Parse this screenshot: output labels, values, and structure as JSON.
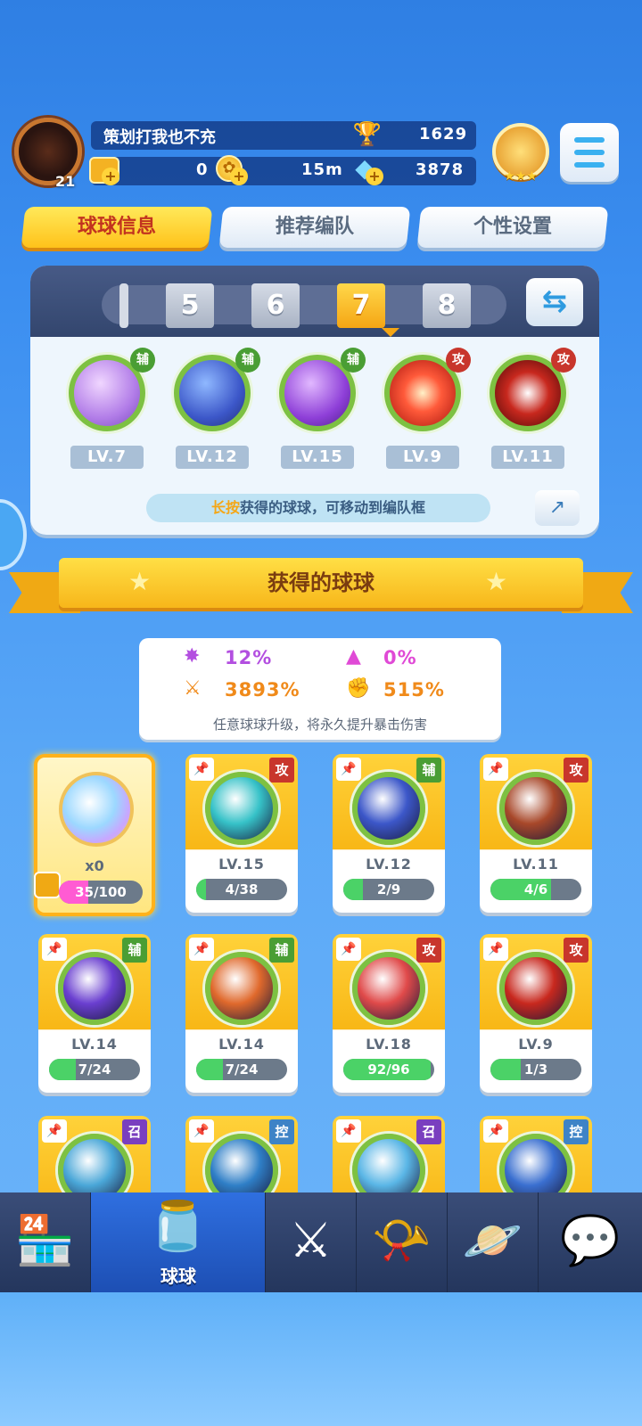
{
  "player": {
    "name": "策划打我也不充",
    "level": "21",
    "trophies": "1629",
    "tickets": "0",
    "coins": "15m",
    "gems": "3878"
  },
  "tabs": [
    {
      "label": "球球信息"
    },
    {
      "label": "推荐编队"
    },
    {
      "label": "个性设置"
    }
  ],
  "team": {
    "pages": [
      "5",
      "6",
      "7",
      "8"
    ],
    "current_page": "7",
    "slots": [
      {
        "level": "LV.7",
        "tag": "辅"
      },
      {
        "level": "LV.12",
        "tag": "辅"
      },
      {
        "level": "LV.15",
        "tag": "辅"
      },
      {
        "level": "LV.9",
        "tag": "攻"
      },
      {
        "level": "LV.11",
        "tag": "攻"
      }
    ],
    "hint_highlight": "长按",
    "hint_text": "获得的球球，可移动到编队框"
  },
  "section_title": "获得的球球",
  "bonus": {
    "crit_rate": "12%",
    "dodge": "0%",
    "crit_damage": "3893%",
    "power": "515%",
    "note": "任意球球升级，将永久提升暴击伤害"
  },
  "special_card": {
    "count": "x0",
    "progress": "35/100",
    "fraction": 0.35
  },
  "cards": [
    {
      "tag": "攻",
      "level": "LV.15",
      "progress": "4/38",
      "fraction": 0.105,
      "color": "#36c2c8"
    },
    {
      "tag": "辅",
      "level": "LV.12",
      "progress": "2/9",
      "fraction": 0.22,
      "color": "#3c57c9"
    },
    {
      "tag": "攻",
      "level": "LV.11",
      "progress": "4/6",
      "fraction": 0.667,
      "color": "#a8482a"
    },
    {
      "tag": "辅",
      "level": "LV.14",
      "progress": "7/24",
      "fraction": 0.29,
      "color": "#6a3fd0"
    },
    {
      "tag": "辅",
      "level": "LV.14",
      "progress": "7/24",
      "fraction": 0.29,
      "color": "#e0692c"
    },
    {
      "tag": "攻",
      "level": "LV.18",
      "progress": "92/96",
      "fraction": 0.958,
      "color": "#e04a4a"
    },
    {
      "tag": "攻",
      "level": "LV.9",
      "progress": "1/3",
      "fraction": 0.333,
      "color": "#c8281e"
    },
    {
      "tag": "召",
      "level": "",
      "progress": "",
      "fraction": 0,
      "color": "#4aa7d8"
    },
    {
      "tag": "控",
      "level": "",
      "progress": "",
      "fraction": 0,
      "color": "#2f7fc7"
    },
    {
      "tag": "召",
      "level": "",
      "progress": "",
      "fraction": 0,
      "color": "#5ab6e6"
    },
    {
      "tag": "控",
      "level": "",
      "progress": "",
      "fraction": 0,
      "color": "#3a6fd0"
    }
  ],
  "nav": {
    "active_label": "球球"
  },
  "colors": {
    "accent_yellow": "#ffc21a",
    "attack_tag": "#c8362c",
    "support_tag": "#4a9e34",
    "summon_tag": "#7a3fbf",
    "control_tag": "#3e83c6"
  }
}
